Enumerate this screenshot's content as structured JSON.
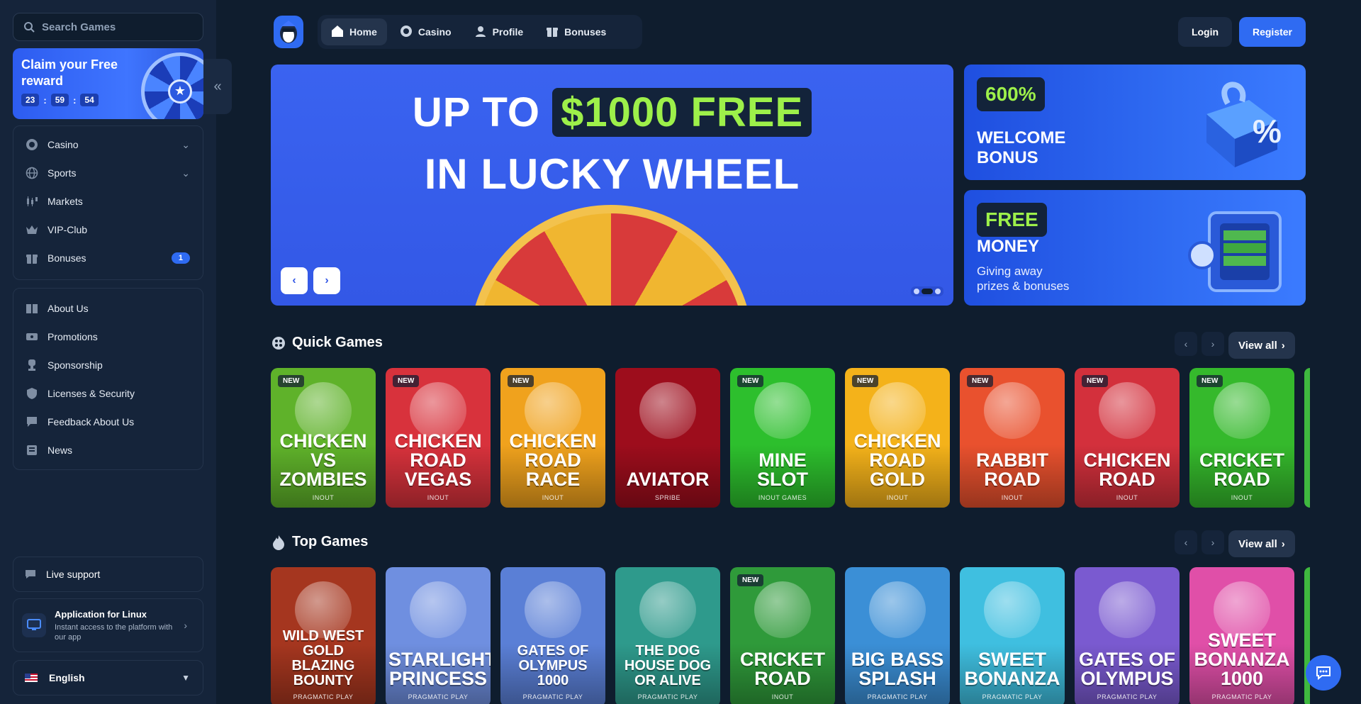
{
  "search": {
    "placeholder": "Search Games"
  },
  "reward": {
    "title": "Claim your Free reward",
    "hours": "23",
    "minutes": "59",
    "seconds": "54"
  },
  "sidebar": {
    "main_items": [
      {
        "label": "Casino",
        "icon": "casino-chip-icon"
      },
      {
        "label": "Sports",
        "icon": "globe-icon"
      },
      {
        "label": "Markets",
        "icon": "candlestick-icon"
      },
      {
        "label": "VIP-Club",
        "icon": "crown-icon"
      },
      {
        "label": "Bonuses",
        "icon": "gift-icon",
        "badge": "1"
      }
    ],
    "info_items": [
      {
        "label": "About Us",
        "icon": "book-icon"
      },
      {
        "label": "Promotions",
        "icon": "ticket-icon"
      },
      {
        "label": "Sponsorship",
        "icon": "trophy-icon"
      },
      {
        "label": "Licenses & Security",
        "icon": "shield-icon"
      },
      {
        "label": "Feedback About Us",
        "icon": "feedback-icon"
      },
      {
        "label": "News",
        "icon": "newspaper-icon"
      }
    ],
    "live_support": "Live support",
    "app": {
      "title": "Application for Linux",
      "subtitle": "Instant access to the platform with our app"
    },
    "language": "English"
  },
  "header": {
    "tabs": [
      {
        "label": "Home",
        "icon": "home-icon"
      },
      {
        "label": "Casino",
        "icon": "casino-chip-icon"
      },
      {
        "label": "Profile",
        "icon": "user-icon"
      },
      {
        "label": "Bonuses",
        "icon": "gift-icon"
      }
    ],
    "login": "Login",
    "register": "Register"
  },
  "hero": {
    "line1_a": "UP TO",
    "line1_b": "$1000 FREE",
    "line2": "IN LUCKY WHEEL",
    "slides_total": 3,
    "active_slide": 2
  },
  "promos": [
    {
      "tag": "600%",
      "title_line1": "WELCOME",
      "title_line2": "BONUS"
    },
    {
      "tag": "FREE",
      "title": "MONEY",
      "subtitle_line1": "Giving away",
      "subtitle_line2": "prizes & bonuses"
    }
  ],
  "quick_games": {
    "title": "Quick Games",
    "view_all": "View all",
    "games": [
      {
        "title": "Chicken vs Zombies",
        "provider": "INOUT",
        "new": true,
        "color": "#5fb22a"
      },
      {
        "title": "Chicken Road Vegas",
        "provider": "INOUT",
        "new": true,
        "color": "#d8323c"
      },
      {
        "title": "Chicken Road Race",
        "provider": "INOUT",
        "new": true,
        "color": "#f0a21d"
      },
      {
        "title": "Aviator",
        "provider": "SPRIBE",
        "new": false,
        "color": "#9d0d1c"
      },
      {
        "title": "Mine Slot",
        "provider": "INOUT GAMES",
        "new": true,
        "color": "#2dbf2d"
      },
      {
        "title": "Chicken Road Gold",
        "provider": "INOUT",
        "new": true,
        "color": "#f4b21a"
      },
      {
        "title": "Rabbit Road",
        "provider": "INOUT",
        "new": true,
        "color": "#e9512e"
      },
      {
        "title": "Chicken Road",
        "provider": "INOUT",
        "new": true,
        "color": "#d3303c"
      },
      {
        "title": "Cricket Road",
        "provider": "INOUT",
        "new": true,
        "color": "#35b92c"
      }
    ]
  },
  "top_games": {
    "title": "Top Games",
    "view_all": "View all",
    "games": [
      {
        "title": "Wild West Gold Blazing Bounty",
        "provider": "PRAGMATIC PLAY",
        "new": false,
        "color": "#a5361f"
      },
      {
        "title": "Starlight Princess",
        "provider": "PRAGMATIC PLAY",
        "new": false,
        "color": "#6f8fe0"
      },
      {
        "title": "Gates of Olympus 1000",
        "provider": "PRAGMATIC PLAY",
        "new": false,
        "color": "#5a7fd6"
      },
      {
        "title": "The Dog House Dog or Alive",
        "provider": "PRAGMATIC PLAY",
        "new": false,
        "color": "#2e9a8c"
      },
      {
        "title": "Cricket Road",
        "provider": "INOUT",
        "new": true,
        "color": "#2f9a3a"
      },
      {
        "title": "Big Bass Splash",
        "provider": "PRAGMATIC PLAY",
        "new": false,
        "color": "#3b8fd6"
      },
      {
        "title": "Sweet Bonanza",
        "provider": "PRAGMATIC PLAY",
        "new": false,
        "color": "#3fbfe0"
      },
      {
        "title": "Gates of Olympus",
        "provider": "PRAGMATIC PLAY",
        "new": false,
        "color": "#7a5ad0"
      },
      {
        "title": "Sweet Bonanza 1000",
        "provider": "PRAGMATIC PLAY",
        "new": false,
        "color": "#e04fa8"
      }
    ]
  }
}
